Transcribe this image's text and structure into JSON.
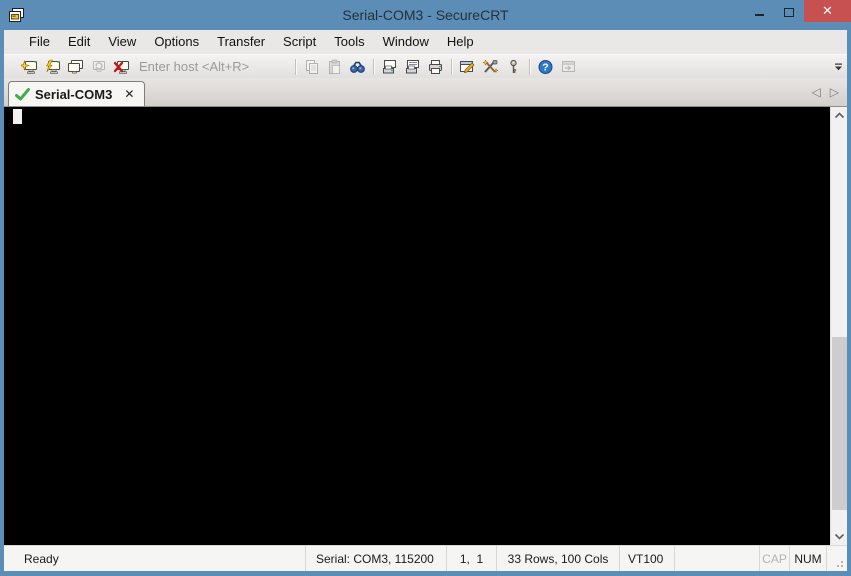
{
  "window": {
    "title": "Serial-COM3 - SecureCRT"
  },
  "titlebar": {
    "controls": {
      "minimize": "minimize",
      "maximize": "maximize",
      "close_label": "✕"
    }
  },
  "menu": {
    "items": [
      "File",
      "Edit",
      "View",
      "Options",
      "Transfer",
      "Script",
      "Tools",
      "Window",
      "Help"
    ]
  },
  "toolbar": {
    "host_placeholder": "Enter host <Alt+R>",
    "icons": [
      {
        "name": "connect-icon",
        "enabled": true
      },
      {
        "name": "quick-connect-icon",
        "enabled": true
      },
      {
        "name": "connect-in-tab-icon",
        "enabled": true
      },
      {
        "name": "reconnect-icon",
        "enabled": false
      },
      {
        "name": "disconnect-icon",
        "enabled": true
      },
      {
        "name": "copy-icon",
        "enabled": false
      },
      {
        "name": "paste-icon",
        "enabled": false
      },
      {
        "name": "find-icon",
        "enabled": true
      },
      {
        "name": "print-screen-icon",
        "enabled": true
      },
      {
        "name": "print-selection-icon",
        "enabled": true
      },
      {
        "name": "print-icon",
        "enabled": true
      },
      {
        "name": "session-options-icon",
        "enabled": true
      },
      {
        "name": "global-options-icon",
        "enabled": true
      },
      {
        "name": "key-agent-icon",
        "enabled": true
      },
      {
        "name": "help-icon",
        "enabled": true
      },
      {
        "name": "securefx-icon",
        "enabled": false
      }
    ]
  },
  "tabs": {
    "items": [
      {
        "label": "Serial-COM3",
        "active": true,
        "status": "connected",
        "close_label": "✕"
      }
    ],
    "nav": {
      "prev": "◁",
      "next": "▷"
    }
  },
  "terminal": {
    "content": "",
    "cursor_visible": true
  },
  "statusbar": {
    "ready": "Ready",
    "connection": "Serial: COM3, 115200",
    "cursor_position": "1,  1",
    "grid_size": "33 Rows, 100 Cols",
    "emulation": "VT100",
    "caps_lock": "CAP",
    "num_lock": "NUM"
  },
  "colors": {
    "titlebar": "#5b8db6",
    "close_button": "#c75050",
    "terminal_bg": "#000000",
    "tab_check_green": "#3fae49"
  }
}
